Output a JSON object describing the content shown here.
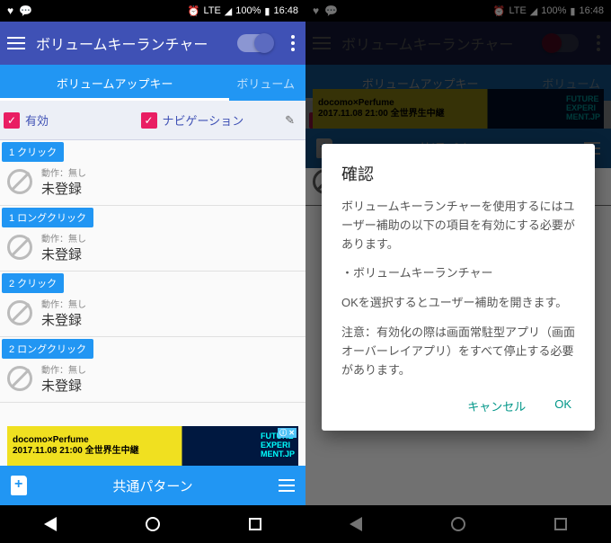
{
  "status": {
    "lte": "LTE",
    "battery": "100%",
    "time": "16:48"
  },
  "toolbar": {
    "title": "ボリュームキーランチャー"
  },
  "tabs": {
    "active": "ボリュームアップキー",
    "inactive": "ボリューム"
  },
  "checks": {
    "enabled": "有効",
    "navigation": "ナビゲーション"
  },
  "sections": {
    "click1": "1 クリック",
    "longclick1": "1 ロングクリック",
    "click2": "2 クリック",
    "longclick2": "2 ロングクリック"
  },
  "action": {
    "sub": "動作：無し",
    "main": "未登録"
  },
  "ad": {
    "line1": "docomo×Perfume",
    "line2": "2017.11.08 21:00 全世界生中継",
    "side1": "FUTURE",
    "side2": "EXPERI",
    "side3": "MENT.JP"
  },
  "bottom": {
    "label": "共通パターン"
  },
  "dialog": {
    "title": "確認",
    "body1": "ボリュームキーランチャーを使用するにはユーザー補助の以下の項目を有効にする必要があります。",
    "body2": "・ボリュームキーランチャー",
    "body3": "OKを選択するとユーザー補助を開きます。",
    "body4": "注意：有効化の際は画面常駐型アプリ（画面オーバーレイアプリ）をすべて停止する必要があります。",
    "cancel": "キャンセル",
    "ok": "OK"
  }
}
